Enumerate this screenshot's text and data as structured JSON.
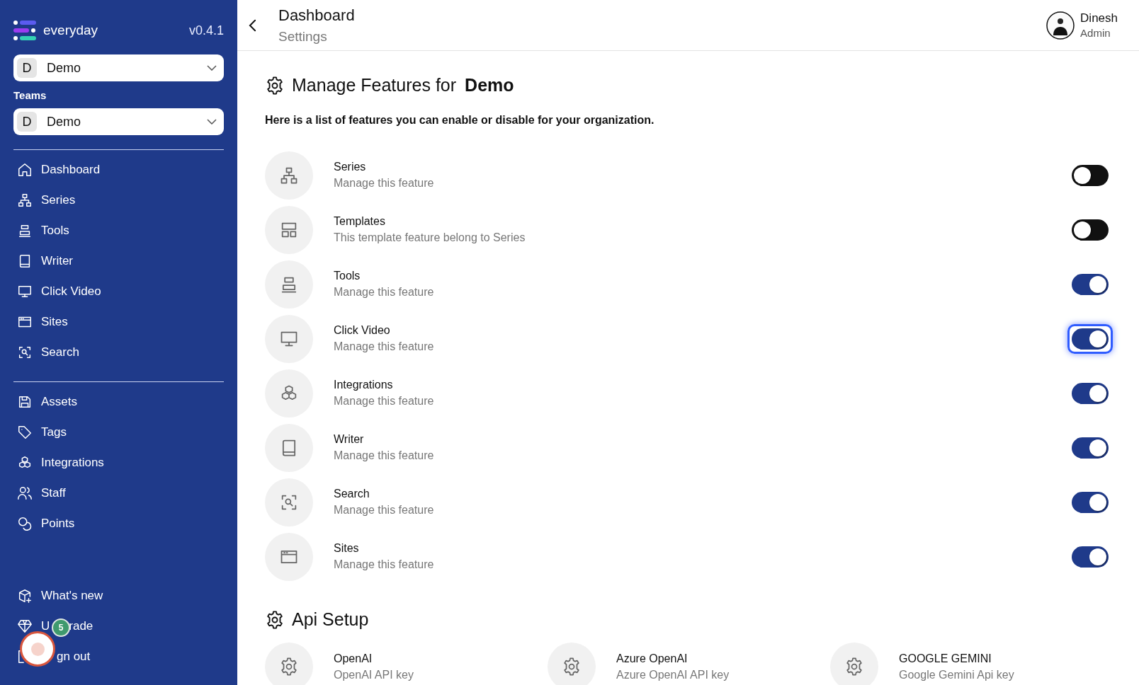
{
  "sidebar": {
    "logo": "everyday",
    "version": "v0.4.1",
    "org_select": {
      "initial": "D",
      "value": "Demo"
    },
    "teams_label": "Teams",
    "team_select": {
      "initial": "D",
      "value": "Demo"
    },
    "nav_groups": [
      [
        {
          "label": "Dashboard"
        },
        {
          "label": "Series"
        },
        {
          "label": "Tools"
        },
        {
          "label": "Writer"
        },
        {
          "label": "Click Video"
        },
        {
          "label": "Sites"
        },
        {
          "label": "Search"
        }
      ],
      [
        {
          "label": "Assets"
        },
        {
          "label": "Tags"
        },
        {
          "label": "Integrations"
        },
        {
          "label": "Staff"
        },
        {
          "label": "Points"
        }
      ]
    ],
    "bottom_items": [
      {
        "parts": [
          "What's new"
        ],
        "kind": "plain"
      },
      {
        "parts": [
          "U",
          "rade"
        ],
        "kind": "gapped"
      },
      {
        "parts": [
          "gn out"
        ],
        "kind": "indented"
      }
    ]
  },
  "notification": {
    "badge": "5"
  },
  "header": {
    "title": "Dashboard",
    "subtitle": "Settings",
    "user": {
      "name": "Dinesh",
      "role": "Admin"
    }
  },
  "features": {
    "title": "Manage Features for",
    "org": "Demo",
    "description": "Here is a list of features you can enable or disable for your organization.",
    "items": [
      {
        "name": "Series",
        "description": "Manage this feature",
        "on": false,
        "focused": false
      },
      {
        "name": "Templates",
        "description": "This template feature belong to Series",
        "on": false,
        "focused": false
      },
      {
        "name": "Tools",
        "description": "Manage this feature",
        "on": true,
        "focused": false
      },
      {
        "name": "Click Video",
        "description": "Manage this feature",
        "on": true,
        "focused": true
      },
      {
        "name": "Integrations",
        "description": "Manage this feature",
        "on": true,
        "focused": false
      },
      {
        "name": "Writer",
        "description": "Manage this feature",
        "on": true,
        "focused": false
      },
      {
        "name": "Search",
        "description": "Manage this feature",
        "on": true,
        "focused": false
      },
      {
        "name": "Sites",
        "description": "Manage this feature",
        "on": true,
        "focused": false
      }
    ]
  },
  "api_setup": {
    "title": "Api Setup",
    "providers": [
      {
        "name": "OpenAI",
        "description": "OpenAI API key"
      },
      {
        "name": "Azure OpenAI",
        "description": "Azure OpenAI API key"
      },
      {
        "name": "GOOGLE GEMINI",
        "description": "Google Gemini Api key"
      }
    ]
  }
}
